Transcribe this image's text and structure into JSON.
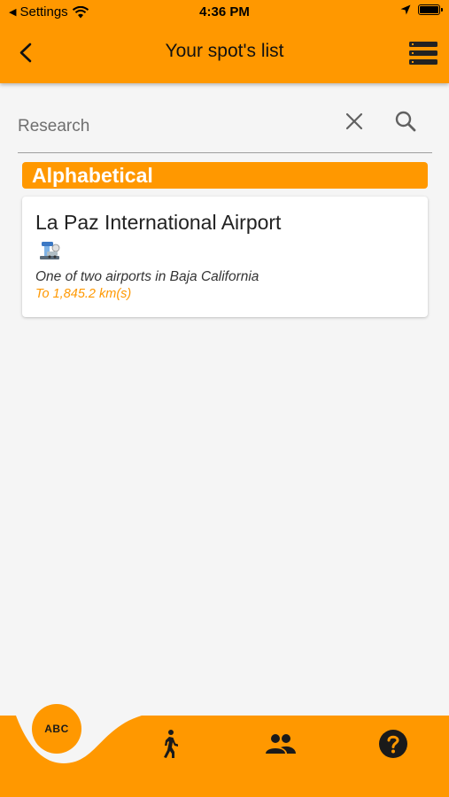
{
  "status_bar": {
    "back_app": "Settings",
    "time": "4:36 PM"
  },
  "app_bar": {
    "title": "Your spot's list",
    "back_icon": "back-arrow-icon",
    "menu_icon": "list-menu-icon"
  },
  "search": {
    "placeholder": "Research",
    "value": "",
    "clear_icon": "close-icon",
    "search_icon": "search-icon"
  },
  "list": {
    "section_label": "Alphabetical",
    "items": [
      {
        "title": "La Paz International Airport",
        "icon": "airport-icon",
        "description": "One of two airports in Baja California",
        "distance": "To 1,845.2 km(s)"
      }
    ]
  },
  "bottom_nav": {
    "items": [
      {
        "label": "ABC",
        "icon": "abc-icon",
        "active": true
      },
      {
        "label": "",
        "icon": "walking-person-icon",
        "active": false
      },
      {
        "label": "",
        "icon": "people-icon",
        "active": false
      },
      {
        "label": "",
        "icon": "help-icon",
        "active": false
      }
    ]
  },
  "colors": {
    "accent": "#ff9800",
    "background": "#f5f5f5",
    "card": "#ffffff"
  }
}
